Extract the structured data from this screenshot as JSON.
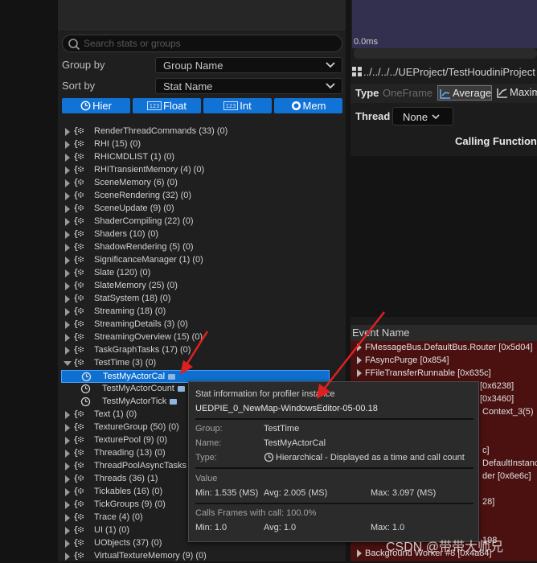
{
  "search": {
    "placeholder": "Search stats or groups"
  },
  "group_by": {
    "label": "Group by",
    "value": "Group Name"
  },
  "sort_by": {
    "label": "Sort by",
    "value": "Stat Name"
  },
  "type_buttons": [
    "Hier",
    "Float",
    "Int",
    "Mem"
  ],
  "tree": {
    "groups_top": [
      "RenderThreadCommands (33) (0)",
      "RHI (15) (0)",
      "RHICMDLIST (1) (0)",
      "RHITransientMemory (4) (0)",
      "SceneMemory (6) (0)",
      "SceneRendering (32) (0)",
      "SceneUpdate (9) (0)",
      "ShaderCompiling (22) (0)",
      "Shaders (10) (0)",
      "ShadowRendering (5) (0)",
      "SignificanceManager (1) (0)",
      "Slate (120) (0)",
      "SlateMemory (25) (0)",
      "StatSystem (18) (0)",
      "Streaming (18) (0)",
      "StreamingDetails (3) (0)",
      "StreamingOverview (15) (0)",
      "TaskGraphTasks (17) (0)"
    ],
    "expanded_group": "TestTime (3) (0)",
    "children": [
      "TestMyActorCal",
      "TestMyActorCount",
      "TestMyActorTick"
    ],
    "groups_bottom": [
      "Text (1) (0)",
      "TextureGroup (50) (0)",
      "TexturePool (9) (0)",
      "Threading (13) (0)",
      "ThreadPoolAsyncTasks",
      "Threads (36) (1)",
      "Tickables (16) (0)",
      "TickGroups (9) (0)",
      "Trace (4) (0)",
      "UI (1) (0)",
      "UObjects (37) (0)",
      "VirtualTextureMemory (9) (0)"
    ]
  },
  "right": {
    "graph_value": "0.0ms",
    "path": "../../../../UEProject/TestHoudiniProject",
    "type_label": "Type",
    "type_options": [
      "OneFrame",
      "Average",
      "Maxim"
    ],
    "thread_label": "Thread",
    "thread_value": "None",
    "calling_functions": "Calling Functions",
    "event_name_header": "Event Name",
    "events": [
      "FMessageBus.DefaultBus.Router [0x5d04]",
      "FAsyncPurge [0x854]",
      "FFileTransferRunnable [0x635c]"
    ],
    "event_fragments": [
      "[0x6238]",
      "[0x3460]",
      "Context_3(5)",
      "c]",
      "DefaultInstanc",
      "der [0x6e6c]",
      "28]",
      "198",
      "Background Worker #8 [0x4a84]"
    ]
  },
  "tooltip": {
    "title": "Stat information for profiler instance",
    "instance": "UEDPIE_0_NewMap-WindowsEditor-05-00.18",
    "group_label": "Group:",
    "group_value": "TestTime",
    "name_label": "Name:",
    "name_value": "TestMyActorCal",
    "type_label": "Type:",
    "type_value": "Hierarchical - Displayed as a time and call count",
    "value_header": "Value",
    "min_value": "Min: 1.535 (MS)",
    "avg_value": "Avg: 2.005 (MS)",
    "max_value": "Max: 3.097 (MS)",
    "calls_header": "Calls Frames with call: 100.0%",
    "min_calls": "Min: 1.0",
    "avg_calls": "Avg: 1.0",
    "max_calls": "Max: 1.0"
  },
  "watermark": "CSDN @带带大师兄",
  "colors": {
    "accent": "#1273d6",
    "selected": "#0f6fd0",
    "event_bg": "#4b1111",
    "arrow": "#e02020"
  }
}
